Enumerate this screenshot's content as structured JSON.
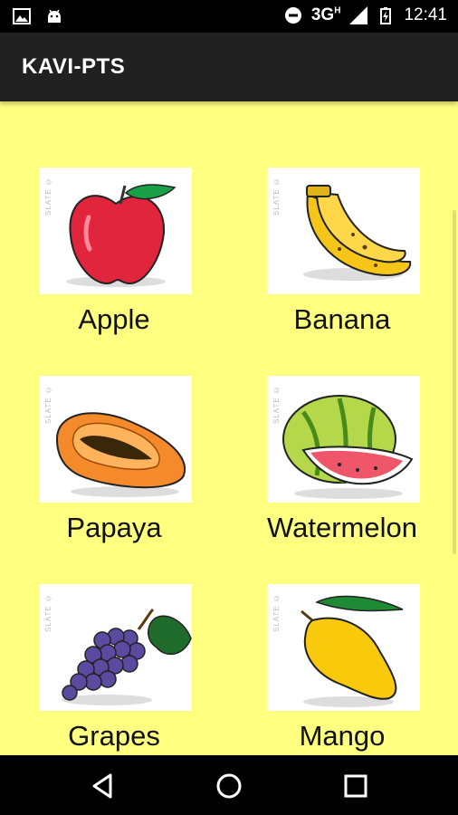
{
  "status_bar": {
    "network": "3G",
    "network_sup": "H",
    "time": "12:41"
  },
  "app_bar": {
    "title": "KAVI-PTS"
  },
  "fruits": [
    {
      "label": "Apple",
      "watermark": "SLATE ©",
      "icon": "apple-icon"
    },
    {
      "label": "Banana",
      "watermark": "SLATE ©",
      "icon": "banana-icon"
    },
    {
      "label": "Papaya",
      "watermark": "SLATE ©",
      "icon": "papaya-icon"
    },
    {
      "label": "Watermelon",
      "watermark": "SLATE ©",
      "icon": "watermelon-icon"
    },
    {
      "label": "Grapes",
      "watermark": "SLATE ©",
      "icon": "grapes-icon"
    },
    {
      "label": "Mango",
      "watermark": "SLATE ©",
      "icon": "mango-icon"
    }
  ],
  "nav_bar": {
    "buttons": [
      "back-icon",
      "home-icon",
      "recents-icon"
    ]
  },
  "colors": {
    "background": "#FFFF80",
    "app_bar": "#212121",
    "status_bar": "#000000"
  }
}
